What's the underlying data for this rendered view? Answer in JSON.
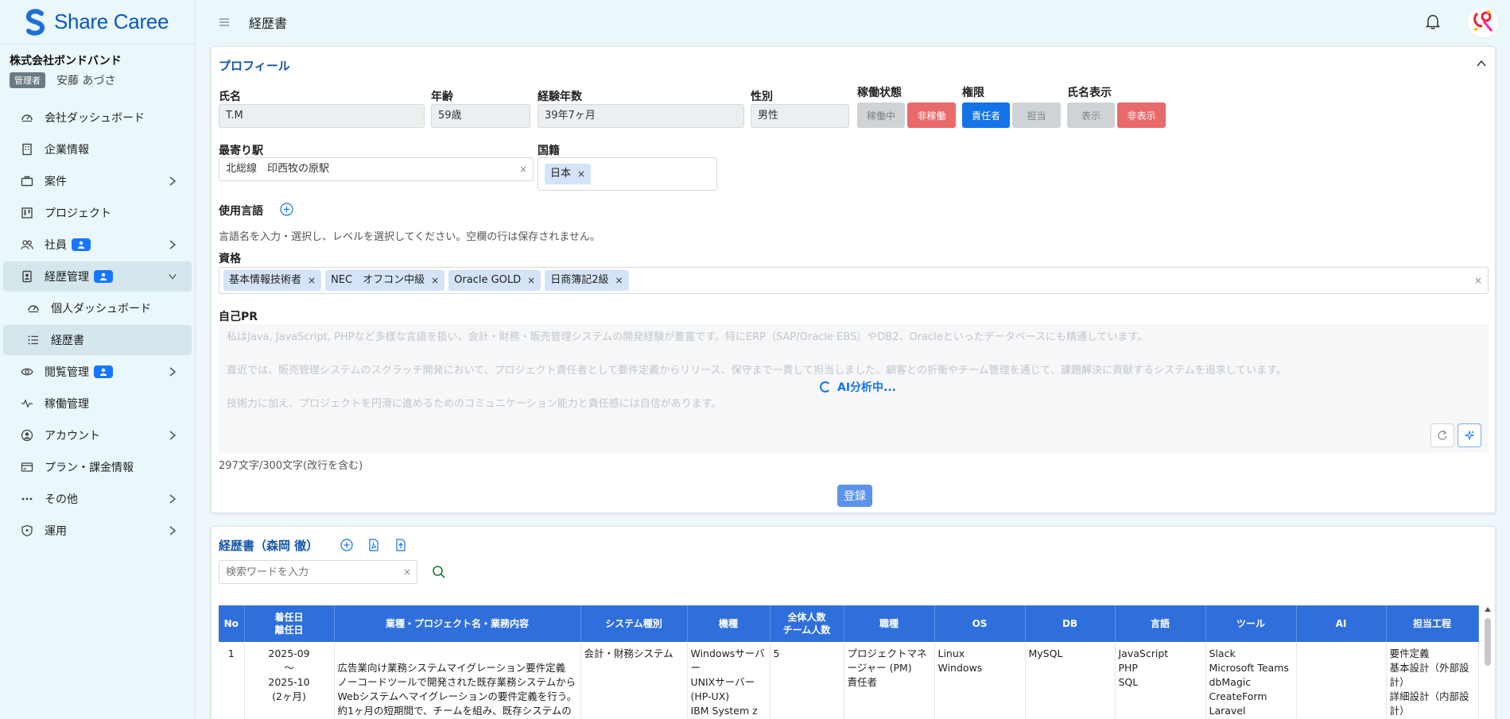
{
  "brand": {
    "name": "Share Caree"
  },
  "sidebar": {
    "company": "株式会社ボンドバンド",
    "role": "管理者",
    "user": "安藤 あづさ",
    "items": [
      {
        "label": "会社ダッシュボード"
      },
      {
        "label": "企業情報"
      },
      {
        "label": "案件"
      },
      {
        "label": "プロジェクト"
      },
      {
        "label": "社員"
      },
      {
        "label": "経歴管理"
      },
      {
        "label": "個人ダッシュボード"
      },
      {
        "label": "経歴書"
      },
      {
        "label": "閲覧管理"
      },
      {
        "label": "稼働管理"
      },
      {
        "label": "アカウント"
      },
      {
        "label": "プラン・課金情報"
      },
      {
        "label": "その他"
      },
      {
        "label": "運用"
      }
    ]
  },
  "header": {
    "title": "経歴書"
  },
  "profile": {
    "title": "プロフィール",
    "name_label": "氏名",
    "name": "T.M",
    "age_label": "年齢",
    "age": "59歳",
    "exp_label": "経験年数",
    "exp": "39年7ヶ月",
    "gender_label": "性別",
    "gender": "男性",
    "status_label": "稼働状態",
    "status_on": "稼働中",
    "status_off": "非稼働",
    "perm_label": "権限",
    "perm_leader": "責任者",
    "perm_member": "担当",
    "display_label": "氏名表示",
    "display_show": "表示",
    "display_hide": "非表示",
    "station_label": "最寄り駅",
    "station": "北総線　印西牧の原駅",
    "nation_label": "国籍",
    "nation": "日本",
    "lang_label": "使用言語",
    "lang_helper": "言語名を入力・選択し、レベルを選択してください。空欄の行は保存されません。",
    "cert_label": "資格",
    "certs": [
      "基本情報技術者",
      "NEC　オフコン中級",
      "Oracle GOLD",
      "日商簿記2級"
    ],
    "pr_label": "自己PR",
    "pr_lines": [
      "私はJava, JavaScript, PHPなど多様な言語を扱い、会計・財務・販売管理システムの開発経験が豊富です。特にERP（SAP/Oracle EBS）やDB2、Oracleといったデータベースにも精通しています。",
      "直近では、販売管理システムのスクラッチ開発において、プロジェクト責任者として要件定義からリリース、保守まで一貫して担当しました。顧客との折衝やチーム管理を通じて、課題解決に貢献するシステムを追求しています。",
      "技術力に加え、プロジェクトを円滑に進めるためのコミュニケーション能力と責任感には自信があります。"
    ],
    "ai_status": "AI分析中...",
    "char_count": "297文字/300文字(改行を含む)",
    "register": "登録",
    "clear_mark": "×"
  },
  "resume": {
    "title": "経歴書（森岡 徹）",
    "search_placeholder": "検索ワードを入力",
    "headers": [
      "No",
      "着任日\n離任日",
      "業種・プロジェクト名・業務内容",
      "システム種別",
      "機種",
      "全体人数\nチーム人数",
      "職種",
      "OS",
      "DB",
      "言語",
      "ツール",
      "AI",
      "担当工程"
    ],
    "rows": [
      {
        "no": "1",
        "start": "2025-09",
        "tilde": "～",
        "end": "2025-10",
        "duration": "(2ヶ月)",
        "project": "広告業向け業務システムマイグレーション要件定義\nノーコードツールで開発された既存業務システムからWebシステムへマイグレーションの要件定義を行う。約1ヶ月の短期間で、チームを組み、既存システムの調査",
        "system": "会計・財務システム",
        "machine": "Windowsサーバー\nUNIXサーバー(HP-UX)\nIBM System z (メ",
        "members": "5",
        "role": "プロジェクトマネージャー (PM)\n責任者",
        "os": "Linux\nWindows",
        "db": "MySQL",
        "lang": "JavaScript\nPHP\nSQL",
        "tools": "Slack\nMicrosoft Teams\ndbMagic\nCreateForm\nLaravel",
        "ai": "",
        "process": "要件定義\n基本設計（外部設計）\n詳細設計（内部設計）"
      }
    ]
  }
}
